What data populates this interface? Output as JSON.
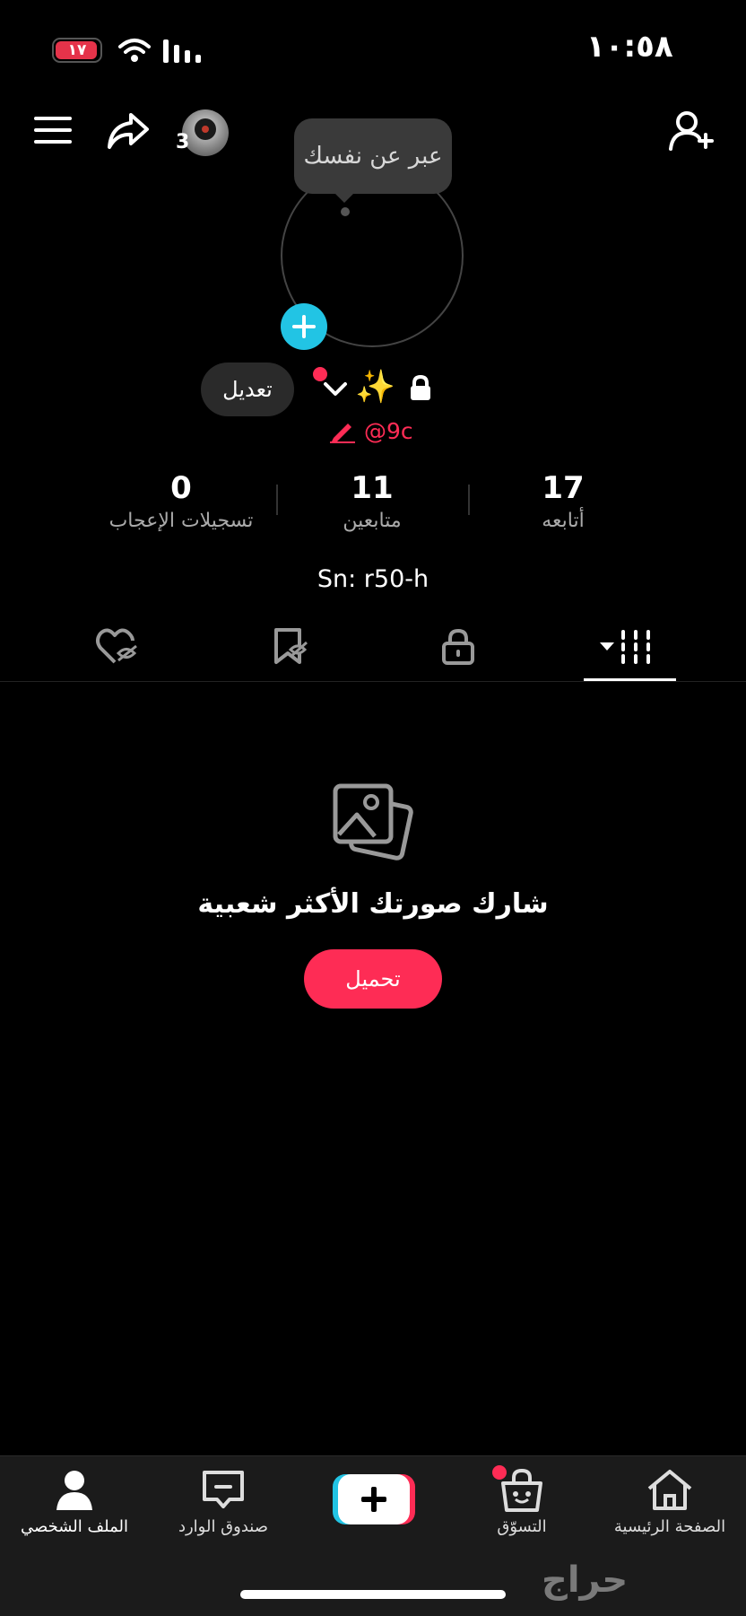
{
  "status_bar": {
    "time": "١٠:٥٨",
    "battery": "١٧"
  },
  "top_bar": {
    "story_count": "3"
  },
  "profile": {
    "tooltip": "عبر عن نفسك",
    "edit_label": "تعديل",
    "name_emoji": "✨",
    "handle": "@9c",
    "bio": "Sn: r50-h"
  },
  "stats": [
    {
      "value": "17",
      "label": "أتابعه"
    },
    {
      "value": "11",
      "label": "متابعين"
    },
    {
      "value": "0",
      "label": "تسجيلات الإعجاب"
    }
  ],
  "tabs": [
    "grid-icon",
    "lock-icon",
    "bookmark-hidden-icon",
    "heart-hidden-icon"
  ],
  "empty_state": {
    "title": "شارك صورتك الأكثر شعبية",
    "button": "تحميل"
  },
  "bottom_nav": {
    "home": "الصفحة الرئيسية",
    "shop": "التسوّق",
    "inbox": "صندوق الوارد",
    "profile": "الملف الشخصي"
  },
  "watermark": "حراج",
  "colors": {
    "accent": "#fe2c55",
    "cyan": "#22c4e4",
    "background": "#000000"
  }
}
